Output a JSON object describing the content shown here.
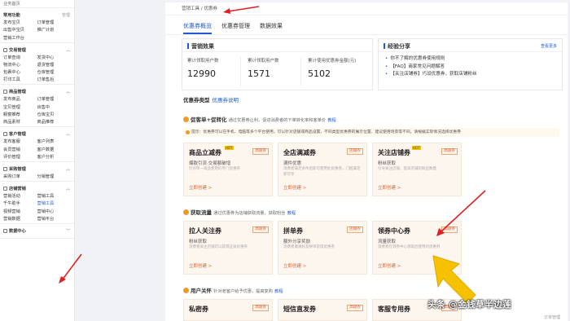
{
  "sidebar": {
    "top": "业务首页",
    "sections": [
      {
        "title": "常用功能",
        "aux": "管理",
        "items": [
          "发布宝贝",
          "订单管理",
          "出售中宝贝",
          "推广计划",
          "营销工作台",
          ""
        ]
      },
      {
        "title": "交易管理",
        "items": [
          "订单查询",
          "发货中心",
          "物流中心",
          "退货管理",
          "包裹中心",
          "仓库管理",
          "打印工具",
          "订单售后"
        ]
      },
      {
        "title": "商品管理",
        "items": [
          "发布商品",
          "订单管理",
          "宝贝管理",
          "出售中",
          "橱窗推荐",
          "仓库宝贝",
          "商品素材",
          "商品推荐"
        ]
      },
      {
        "title": "客户管理",
        "items": [
          "发布客服",
          "客户列表",
          "会员营销",
          "客户数据",
          "评价管理",
          "客户分析"
        ]
      },
      {
        "title": "采购管理",
        "items": [
          "采购订单",
          "分销管理"
        ]
      },
      {
        "title": "店铺营销",
        "items": [
          "营销活动",
          "营销工具",
          "千牛助手",
          "营销工具",
          "视频营销",
          "营销中心",
          "营销数据",
          "营销平台"
        ]
      },
      {
        "title": "数据中心",
        "items": []
      }
    ]
  },
  "breadcrumb": "营销工具 / 优惠券",
  "tabs": [
    "优惠券概览",
    "优惠券管理",
    "数据效果"
  ],
  "results": {
    "title": "营销效果",
    "stats": [
      {
        "label": "累计领取用户数",
        "value": "12990"
      },
      {
        "label": "累计领取用户数",
        "value": "1571"
      },
      {
        "label": "累计使用优惠券金额(元)",
        "value": "5102"
      }
    ]
  },
  "experience": {
    "title": "经验分享",
    "more": "查看更多",
    "articles": [
      "你不了解的优惠券使用规则",
      "【FAQ】商家常见问题解答",
      "【关注店铺券】巧设优惠券，获取店铺粉丝"
    ]
  },
  "types": {
    "title": "优惠券类型",
    "link": "优惠券说明"
  },
  "cat1": {
    "name": "促客单+促转化",
    "desc": "通过优惠券让利，促进消费者的下单转化率和客单价",
    "link": "教程"
  },
  "notice": "提示：优惠券可以在手机、电脑等多个平台使用，可以针对店铺或商品设置，不同类型优惠券的展示位置、建议使用场景等不同，请根据实际情况选择优惠券",
  "cards1": [
    {
      "name": "商品立减券",
      "hot": "HOT",
      "badge": "高级券",
      "sub": "爆款引流·交易额破增",
      "desc": "针对单一商品使用的专门优惠券",
      "go": "立即创建 >"
    },
    {
      "name": "全店满减券",
      "badge": "店铺券",
      "sub": "满件优惠",
      "desc": "消费者满足条件后即可使用此优惠券，门槛满足即可享",
      "go": "立即创建 >"
    },
    {
      "name": "关注店铺券",
      "hot": "HOT",
      "badge": "高级券",
      "sub": "粉丝获取",
      "desc": "引导关注店铺，提高店铺的粉丝数量",
      "go": "立即创建 >"
    }
  ],
  "cat2": {
    "name": "获取流量",
    "desc": "通过优惠券为店铺获取流量，获取粉丝",
    "link": "教程"
  },
  "cards2": [
    {
      "name": "拉人关注券",
      "badge": "高级券",
      "sub": "粉丝获取",
      "desc": "消费者关注店铺可以获得这张优惠券",
      "go": "立即创建 >"
    },
    {
      "name": "拼单券",
      "badge": "店铺券",
      "sub": "额外分享奖励",
      "desc": "消费者邀请好友拼单获得优惠券",
      "go": "立即创建 >"
    },
    {
      "name": "领券中心券",
      "badge": "高级券",
      "sub": "流量获取",
      "desc": "消费者在领券中心领取后使用的优惠券",
      "go": "立即创建 >"
    }
  ],
  "cat3": {
    "name": "用户关怀",
    "desc": "针对老客户给予优惠，提高复购",
    "link": "教程"
  },
  "cards3": [
    {
      "name": "私密券",
      "badge": "高级券"
    },
    {
      "name": "短信直发券",
      "badge": "高级券"
    },
    {
      "name": "客服专用券",
      "badge": "高级券"
    }
  ],
  "watermark": "头条 @金钱草半边莲",
  "right_strip": "订单管理"
}
